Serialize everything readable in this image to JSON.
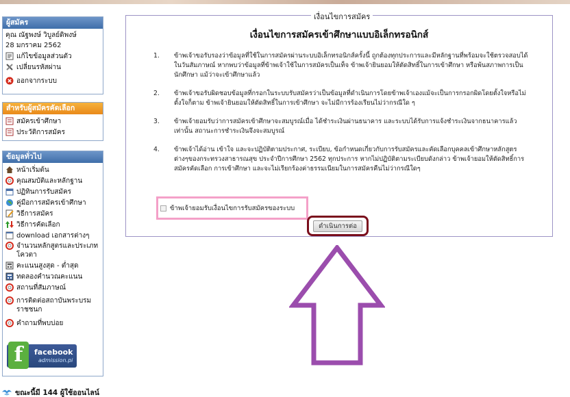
{
  "applicant_panel": {
    "title": "ผู้สมัคร",
    "name": "คุณ ณัฐพงษ์ วิบูลย์ดิพงษ์",
    "date": "28 มกราคม 2562",
    "edit_profile": "แก้ไขข้อมูลส่วนตัว",
    "change_password": "เปลี่ยนรหัสผ่าน",
    "logout": "ออกจากระบบ"
  },
  "selected_panel": {
    "title": "สำหรับผู้สมัครคัดเลือก",
    "items": [
      "สมัครเข้าศึกษา",
      "ประวัติการสมัคร"
    ]
  },
  "general_panel": {
    "title": "ข้อมูลทั่วไป",
    "items": [
      "หน้าเริ่มต้น",
      "คุณสมบัติและหลักฐาน",
      "ปฏิทินการรับสมัคร",
      "คู่มือการสมัครเข้าศึกษา",
      "วิธีการสมัคร",
      "วิธีการคัดเลือก",
      "download เอกสารต่างๆ",
      "จำนวนหลักสูตรและประเภทโควตา",
      "คะแนนสูงสุด - ต่ำสุด",
      "ทดลองคำนวณคะแนน",
      "สถานที่สัมภาษณ์",
      "การติดต่อสถาบันพระบรมราชชนก",
      "คำถามที่พบบ่อย"
    ]
  },
  "facebook": {
    "label": "facebook",
    "sub": "admission.pi"
  },
  "online": "ขณะนี้มี 144 ผู้ใช้ออนไลน์",
  "conditions": {
    "legend": "เงื่อนไขการสมัคร",
    "title": "เงื่อนไขการสมัครเข้าศึกษาแบบอิเล็กทรอนิกส์",
    "terms": [
      {
        "num": "1.",
        "text": "ข้าพเจ้าขอรับรองว่าข้อมูลที่ใช้ในการสมัครผ่านระบบอิเล็กทรอนิกส์ครั้งนี้ ถูกต้องทุกประการและมีหลักฐานที่พร้อมจะใช้ตรวจสอบได้ในวันสัมภาษณ์ หากพบว่าข้อมูลที่ข้าพเจ้าใช้ในการสมัครเป็นเท็จ ข้าพเจ้ายินยอมให้ตัดสิทธิ์ในการเข้าศึกษา หรือพ้นสภาพการเป็นนักศึกษา แม้ว่าจะเข้าศึกษาแล้ว"
      },
      {
        "num": "2.",
        "text": "ข้าพเจ้าขอรับผิดชอบข้อมูลที่กรอกในระบบรับสมัครว่าเป็นข้อมูลที่ดำเนินการโดยข้าพเจ้าเองแม้จะเป็นการกรอกผิดโดยตั้งใจหรือไม่ตั้งใจก็ตาม ข้าพเจ้ายินยอมให้ตัดสิทธิ์ในการเข้าศึกษา จะไม่มีการร้องเรียนไม่ว่ากรณีใด ๆ"
      },
      {
        "num": "3.",
        "text": "ข้าพเจ้ายอมรับว่าการสมัครเข้าศึกษาจะสมบูรณ์เมื่อ ได้ชำระเงินผ่านธนาคาร และระบบได้รับการแจ้งชำระเงินจากธนาคารแล้วเท่านั้น สถานะการชำระเงินจึงจะสมบูรณ์"
      },
      {
        "num": "4.",
        "text": "ข้าพเจ้าได้อ่าน เข้าใจ และจะปฏิบัติตามประกาศ, ระเบียบ, ข้อกำหนดเกี่ยวกับการรับสมัครและคัดเลือกบุคคลเข้าศึกษาหลักสูตรต่างๆของกระทรวงสาธารณสุข ประจำปีการศึกษา 2562 ทุกประการ หากไม่ปฏิบัติตามระเบียบดังกล่าว ข้าพเจ้ายอมให้ตัดสิทธิ์การสมัครคัดเลือก การเข้าศึกษา และจะไม่เรียกร้องค่าธรรมเนียมในการสมัครคืนไม่ว่ากรณีใดๆ"
      }
    ],
    "agree_label": "ข้าพเจ้ายอมรับเงื่อนไขการรับสมัครของระบบ",
    "proceed_button": "ดำเนินการต่อ"
  },
  "colors": {
    "panel_header_blue": "#3f6ea9",
    "panel_header_orange": "#e9891a",
    "highlight_pink": "#f4a0c8",
    "button_ring": "#7a0e1c",
    "arrow_purple": "#9b4dad"
  }
}
